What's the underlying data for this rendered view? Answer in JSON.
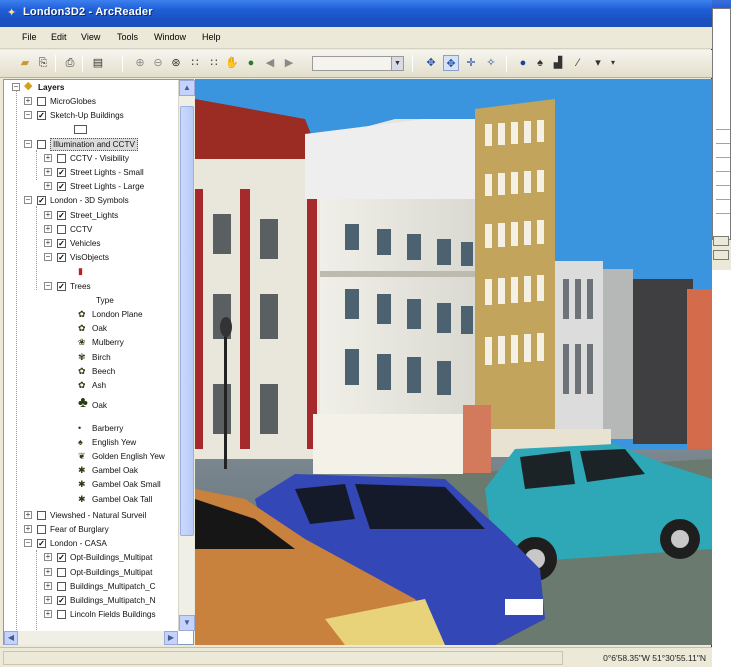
{
  "window": {
    "title": "London3D2 - ArcReader",
    "icon": "globe-app-icon"
  },
  "menu": [
    "File",
    "Edit",
    "View",
    "Tools",
    "Window",
    "Help"
  ],
  "toolbar": {
    "scale_combo_value": "",
    "icons": [
      "open-icon",
      "open-doc-icon",
      "print-icon",
      "page-icon",
      "zoom-in-icon",
      "zoom-out-icon",
      "zoom-all-icon",
      "fixed-zoom-in-icon",
      "fixed-zoom-out-icon",
      "pan-icon",
      "full-extent-icon",
      "back-icon",
      "forward-icon",
      "navigate-icon",
      "fly-icon",
      "center-icon",
      "target-icon",
      "identify-icon",
      "find-icon",
      "measure-icon",
      "draw-icon",
      "dropdown-arrow-icon"
    ]
  },
  "toc": {
    "root": "Layers",
    "rows": [
      {
        "label": "MicroGlobes",
        "checked": false,
        "indent": 1,
        "exp": "+"
      },
      {
        "label": "Sketch-Up Buildings",
        "checked": true,
        "indent": 1,
        "exp": "−"
      },
      {
        "label": "",
        "swatch": true,
        "indent": 2
      },
      {
        "label": "Illumination and CCTV",
        "checked": false,
        "indent": 1,
        "exp": "−",
        "selected": true
      },
      {
        "label": "CCTV - Visibility",
        "checked": false,
        "indent": 2,
        "exp": "+"
      },
      {
        "label": "Street Lights - Small",
        "checked": true,
        "indent": 2,
        "exp": "+"
      },
      {
        "label": "Street Lights - Large",
        "checked": true,
        "indent": 2,
        "exp": "+"
      },
      {
        "label": "London - 3D Symbols",
        "checked": true,
        "indent": 1,
        "exp": "−"
      },
      {
        "label": "Street_Lights",
        "checked": true,
        "indent": 2,
        "exp": "+"
      },
      {
        "label": "CCTV",
        "checked": false,
        "indent": 2,
        "exp": "+"
      },
      {
        "label": "Vehicles",
        "checked": true,
        "indent": 2,
        "exp": "+"
      },
      {
        "label": "VisObjects",
        "checked": true,
        "indent": 2,
        "exp": "−"
      },
      {
        "label": "",
        "redsym": true,
        "indent": 3
      },
      {
        "label": "Trees",
        "checked": true,
        "indent": 2,
        "exp": "−"
      }
    ],
    "legend_heading": "Type",
    "legend": [
      {
        "label": "London Plane",
        "sym": "✿"
      },
      {
        "label": "Oak",
        "sym": "✿"
      },
      {
        "label": "Mulberry",
        "sym": "❀"
      },
      {
        "label": "Birch",
        "sym": "✾"
      },
      {
        "label": "Beech",
        "sym": "✿"
      },
      {
        "label": "Ash",
        "sym": "✿"
      },
      {
        "label": "Oak",
        "sym": "♣",
        "big": true
      },
      {
        "label": "Barberry",
        "sym": "•"
      },
      {
        "label": "English Yew",
        "sym": "♠"
      },
      {
        "label": "Golden English Yew",
        "sym": "❦"
      },
      {
        "label": "Gambel Oak",
        "sym": "✱"
      },
      {
        "label": "Gambel Oak Small",
        "sym": "✱"
      },
      {
        "label": "Gambel Oak Tall",
        "sym": "✱"
      }
    ],
    "rows_bottom": [
      {
        "label": "Viewshed - Natural Surveil",
        "checked": false,
        "indent": 1,
        "exp": "+"
      },
      {
        "label": "Fear of Burglary",
        "checked": false,
        "indent": 1,
        "exp": "+"
      },
      {
        "label": "London - CASA",
        "checked": true,
        "indent": 1,
        "exp": "−"
      },
      {
        "label": "Opt-Buildings_Multipat",
        "checked": true,
        "indent": 2,
        "exp": "+"
      },
      {
        "label": "Opt-Buildings_Multipat",
        "checked": false,
        "indent": 2,
        "exp": "+"
      },
      {
        "label": "Buildings_Multipatch_C",
        "checked": false,
        "indent": 2,
        "exp": "+"
      },
      {
        "label": "Buildings_Multipatch_N",
        "checked": true,
        "indent": 2,
        "exp": "+"
      },
      {
        "label": "Lincoln Fields Buildings",
        "checked": false,
        "indent": 2,
        "exp": "+"
      }
    ]
  },
  "status": {
    "coordinates": "0°6'58.35\"W  51°30'55.11\"N"
  },
  "colors": {
    "title_bar": "#1f5fd6",
    "sky": "#3b95de",
    "window_bg": "#ece9d8"
  }
}
